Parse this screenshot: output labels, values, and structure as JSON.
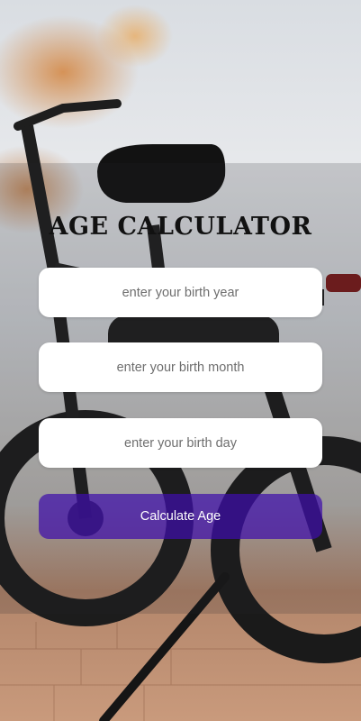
{
  "app": {
    "title": "AGE CALCULATOR"
  },
  "form": {
    "year_placeholder": "enter your birth year",
    "month_placeholder": "enter your birth month",
    "day_placeholder": "enter your birth day",
    "year_value": "",
    "month_value": "",
    "day_value": "",
    "submit_label": "Calculate Age"
  },
  "colors": {
    "button": "#3e0eaa",
    "panel_overlay": "#28282d",
    "field_background": "#ffffff",
    "title_text": "#111111"
  }
}
